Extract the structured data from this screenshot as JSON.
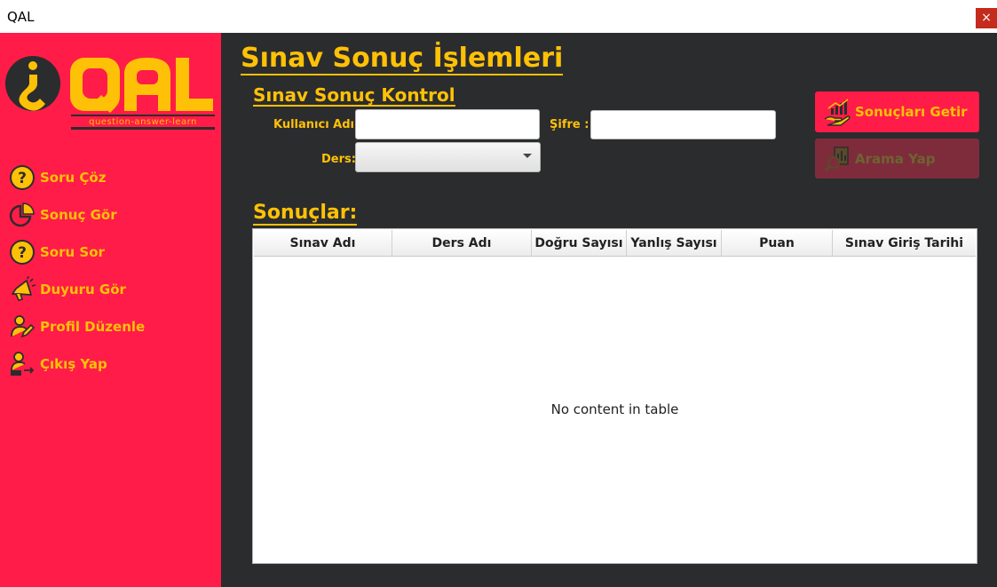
{
  "window": {
    "title": "QAL",
    "close_label": "×"
  },
  "logo": {
    "wordmark": "QAL",
    "tagline": "question-answer-learn"
  },
  "sidebar": {
    "items": [
      {
        "label": "Soru Çöz",
        "icon": "question-circle-icon"
      },
      {
        "label": "Sonuç Gör",
        "icon": "pie-chart-icon"
      },
      {
        "label": "Soru Sor",
        "icon": "question-circle-icon"
      },
      {
        "label": "Duyuru Gör",
        "icon": "megaphone-icon"
      },
      {
        "label": "Profil Düzenle",
        "icon": "user-edit-icon"
      },
      {
        "label": "Çıkış Yap",
        "icon": "user-logout-icon"
      }
    ]
  },
  "main": {
    "title": "Sınav Sonuç İşlemleri",
    "subtitle": "Sınav Sonuç Kontrol",
    "form": {
      "username_label": "Kullanıcı Adı:",
      "username_value": "",
      "password_label": "Şifre :",
      "password_value": "",
      "course_label": "Ders:",
      "course_value": ""
    },
    "buttons": {
      "get_results": "Sonuçları Getir",
      "search": "Arama Yap"
    },
    "results_title": "Sonuçlar:",
    "table": {
      "columns": [
        "Sınav Adı",
        "Ders Adı",
        "Doğru Sayısı",
        "Yanlış Sayısı",
        "Puan",
        "Sınav Giriş Tarihi"
      ],
      "rows": [],
      "empty_text": "No content in table"
    }
  },
  "colors": {
    "accent": "#ffc107",
    "sidebar": "#ff1c48",
    "background": "#2b2c2e",
    "button_disabled": "#7e2c3b"
  }
}
